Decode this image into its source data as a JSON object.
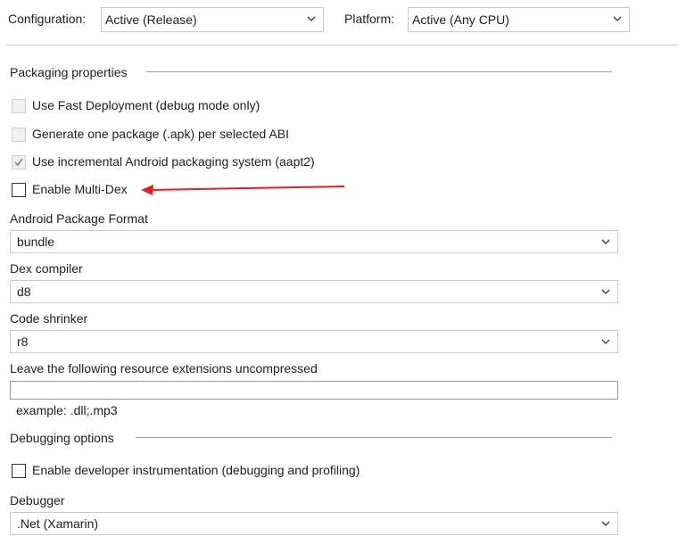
{
  "toolbar": {
    "configuration_label": "Configuration:",
    "configuration_value": "Active (Release)",
    "platform_label": "Platform:",
    "platform_value": "Active (Any CPU)"
  },
  "packaging": {
    "section_title": "Packaging properties",
    "fast_deployment": {
      "label": "Use Fast Deployment (debug mode only)",
      "checked": false,
      "enabled": false
    },
    "per_abi": {
      "label": "Generate one package (.apk) per selected ABI",
      "checked": false,
      "enabled": false
    },
    "aapt2": {
      "label": "Use incremental Android packaging system (aapt2)",
      "checked": true,
      "enabled": false
    },
    "multidex": {
      "label": "Enable Multi-Dex",
      "checked": false,
      "enabled": true
    },
    "package_format": {
      "label": "Android Package Format",
      "value": "bundle"
    },
    "dex_compiler": {
      "label": "Dex compiler",
      "value": "d8"
    },
    "code_shrinker": {
      "label": "Code shrinker",
      "value": "r8"
    },
    "uncompressed": {
      "label": "Leave the following resource extensions uncompressed",
      "value": "",
      "hint": "example: .dll;.mp3"
    }
  },
  "debugging": {
    "section_title": "Debugging options",
    "instrumentation": {
      "label": "Enable developer instrumentation (debugging and profiling)",
      "checked": false,
      "enabled": true
    },
    "debugger": {
      "label": "Debugger",
      "value": ".Net (Xamarin)"
    }
  },
  "annotation": {
    "arrow_color": "#e3201b",
    "icon": "red-arrow-icon"
  },
  "colors": {
    "border": "#cccccc",
    "text": "#1e1e1e",
    "disabled_box": "#f0f0f0"
  }
}
